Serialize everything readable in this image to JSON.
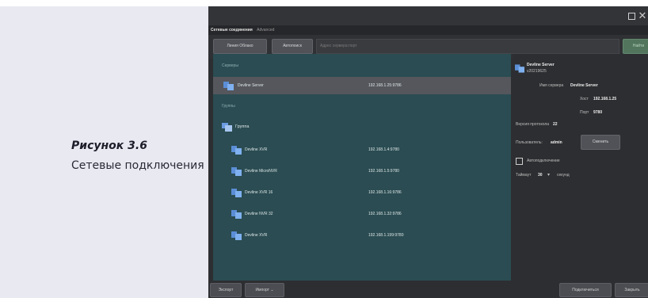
{
  "caption": {
    "figure_label": "Рисунок 3.6",
    "figure_description": "Сетевые подключения"
  },
  "window": {
    "tabs": [
      "Сетевые соединения",
      "Advanced"
    ],
    "toolbar": {
      "profiles_button": "Линия Облако",
      "auto_button": "Автопоиск",
      "address_placeholder": "Адрес сервера:порт",
      "find_button": "Найти"
    },
    "list": {
      "servers_header": "Серверы",
      "groups_header": "Группы",
      "servers": [
        {
          "name": "Devline Server",
          "address": "192.168.1.25:9786"
        }
      ],
      "group": {
        "name": "Группа",
        "items": [
          {
            "name": "Devline XVR",
            "address": "192.168.1.4:9780"
          },
          {
            "name": "Devline MicroNVR",
            "address": "192.168.1.5:9780"
          },
          {
            "name": "Devline XVR 16",
            "address": "192.168.1.16:9786"
          },
          {
            "name": "Devline NVR 32",
            "address": "192.168.1.32:9786"
          },
          {
            "name": "Devline XVR",
            "address": "192.168.1.199:9780"
          }
        ]
      }
    },
    "details": {
      "server_title": "Devline Server",
      "server_version": "v20219625",
      "server_name_label": "Имя сервера",
      "server_name_value": "Devline Server",
      "host_label": "Хост",
      "host_value": "192.168.1.25",
      "port_label": "Порт",
      "port_value": "9780",
      "protocol_label": "Версия протокола",
      "protocol_value": "22",
      "user_label": "Пользователь:",
      "user_value": "admin",
      "change_button": "Сменить",
      "autoconnect_label": "Автоподключение",
      "timeout_label": "Таймаут",
      "timeout_value": "30",
      "timeout_unit": "секунд"
    },
    "bottombar": {
      "export_button": "Экспорт",
      "import_button": "Импорт",
      "connect_button": "Подключиться",
      "close_button": "Закрыть"
    }
  },
  "colors": {
    "window_bg": "#2d2e31",
    "list_bg": "#2a4c52",
    "selected_row": "#55575c",
    "caption_bg": "#e9e9f2"
  }
}
